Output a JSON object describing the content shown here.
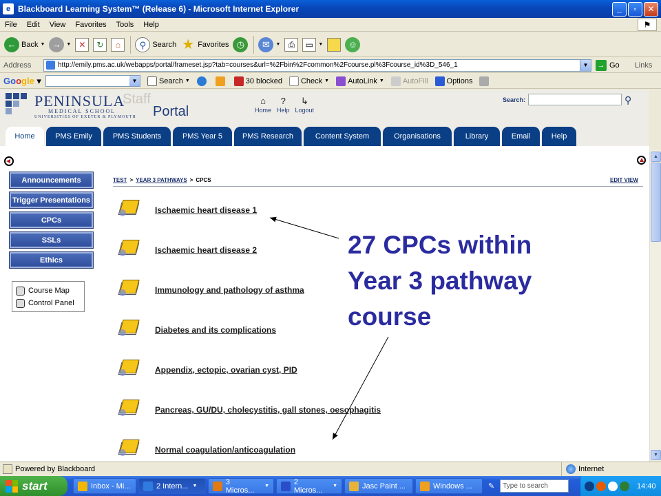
{
  "window": {
    "title": "Blackboard Learning System™ (Release 6) - Microsoft Internet Explorer"
  },
  "menu": [
    "File",
    "Edit",
    "View",
    "Favorites",
    "Tools",
    "Help"
  ],
  "toolbar": {
    "back": "Back",
    "search": "Search",
    "favorites": "Favorites"
  },
  "address": {
    "label": "Address",
    "url": "http://emily.pms.ac.uk/webapps/portal/frameset.jsp?tab=courses&url=%2Fbin%2Fcommon%2Fcourse.pl%3Fcourse_id%3D_546_1",
    "go": "Go",
    "links": "Links"
  },
  "googlebar": {
    "logo_g": "Go",
    "logo_o": "o",
    "logo_rest": "gle",
    "search": "Search",
    "blocked": "30 blocked",
    "check": "Check",
    "autolink": "AutoLink",
    "autofill": "AutoFill",
    "options": "Options"
  },
  "portal": {
    "name": "PENINSULA",
    "sub1": "MEDICAL SCHOOL",
    "sub2": "UNIVERSITIES OF EXETER & PLYMOUTH",
    "staff": "Staff",
    "portal": "Portal",
    "nav": [
      {
        "label": "Home",
        "icon": "⌂"
      },
      {
        "label": "Help",
        "icon": "?"
      },
      {
        "label": "Logout",
        "icon": "↳"
      }
    ],
    "search_label": "Search:"
  },
  "tabs": [
    {
      "label": "Home",
      "w": 56
    },
    {
      "label": "PMS Emily",
      "w": 80
    },
    {
      "label": "PMS Students",
      "w": 98
    },
    {
      "label": "PMS Year 5",
      "w": 86
    },
    {
      "label": "PMS Research",
      "w": 98
    },
    {
      "label": "Content System",
      "w": 112
    },
    {
      "label": "Organisations",
      "w": 100
    },
    {
      "label": "Library",
      "w": 67
    },
    {
      "label": "Email",
      "w": 55
    },
    {
      "label": "Help",
      "w": 50
    }
  ],
  "side_buttons": [
    "Announcements",
    "Trigger Presentations",
    "CPCs",
    "SSLs",
    "Ethics"
  ],
  "tools": [
    "Course Map",
    "Control Panel"
  ],
  "breadcrumb": {
    "items": [
      "TEST",
      "YEAR 3 PATHWAYS"
    ],
    "current": "CPCS",
    "sep": ">"
  },
  "edit_view": "EDIT VIEW",
  "cpcs": [
    "Ischaemic heart disease 1",
    "Ischaemic heart disease 2",
    "Immunology and pathology of asthma",
    "Diabetes and its complications",
    "Appendix, ectopic, ovarian cyst, PID",
    "Pancreas, GU/DU, cholecystitis, gall stones, oesophagitis",
    "Normal coagulation/anticoagulation"
  ],
  "callout": [
    "27 CPCs within",
    "Year 3 pathway",
    "course"
  ],
  "status": {
    "text": "Powered by Blackboard",
    "zone": "Internet"
  },
  "taskbar": {
    "start": "start",
    "tasks": [
      {
        "label": "Inbox - Mi...",
        "color": "#f2b705",
        "dd": false,
        "w": 92
      },
      {
        "label": "2 Intern...",
        "color": "#2f7be0",
        "dd": true,
        "w": 98,
        "active": true
      },
      {
        "label": "3 Micros...",
        "color": "#e07a12",
        "dd": true,
        "w": 96
      },
      {
        "label": "2 Micros...",
        "color": "#2a4ec8",
        "dd": true,
        "w": 96
      },
      {
        "label": "Jasc Paint ...",
        "color": "#e6b23a",
        "dd": false,
        "w": 100
      },
      {
        "label": "Windows ...",
        "color": "#f0a020",
        "dd": false,
        "w": 98
      }
    ],
    "search_placeholder": "Type to search",
    "clock": "14:40"
  }
}
